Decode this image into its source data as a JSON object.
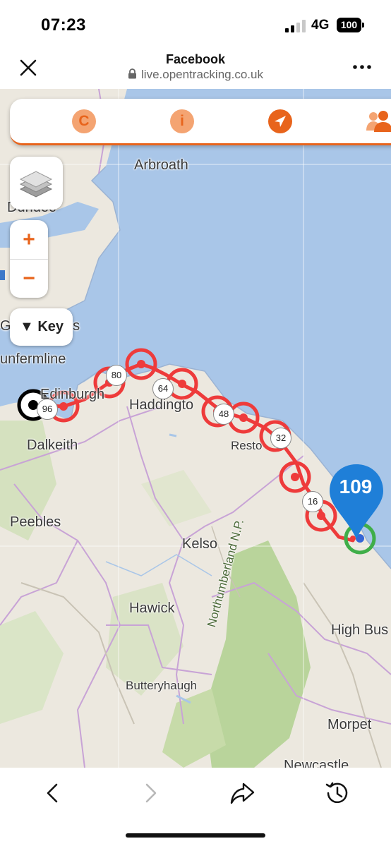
{
  "status_bar": {
    "time": "07:23",
    "network": "4G",
    "battery": "100"
  },
  "browser": {
    "title": "Facebook",
    "url": "live.opentracking.co.uk"
  },
  "toolbar": {
    "buttons": [
      {
        "icon": "c-icon",
        "label": "C"
      },
      {
        "icon": "info-icon",
        "label": "i"
      },
      {
        "icon": "navigation-arrow-icon",
        "label": ""
      },
      {
        "icon": "people-icon",
        "label": ""
      }
    ],
    "accent": "#e8641c"
  },
  "map_controls": {
    "zoom_in": "+",
    "zoom_out": "−",
    "key_label": "▼ Key"
  },
  "places": {
    "arbroath": "Arbroath",
    "dundee": "Dundee",
    "glenrothes": "Gl",
    "es": "es",
    "dunfermline": "unfermline",
    "edinburgh": "Edinburgh",
    "haddington": "Haddingto",
    "dalkeith": "Dalkeith",
    "reston": "Resto",
    "peebles": "Peebles",
    "kelso": "Kelso",
    "hawick": "Hawick",
    "butteryhaugh": "Butteryhaugh",
    "northumberland": "Northumberland N.P.",
    "high_buston": "High Bus",
    "morpeth": "Morpet",
    "newcastle": "Newcastle"
  },
  "route": {
    "color": "#ee3b3b",
    "badges": [
      "96",
      "80",
      "64",
      "48",
      "32",
      "16"
    ],
    "current_count": "109"
  }
}
